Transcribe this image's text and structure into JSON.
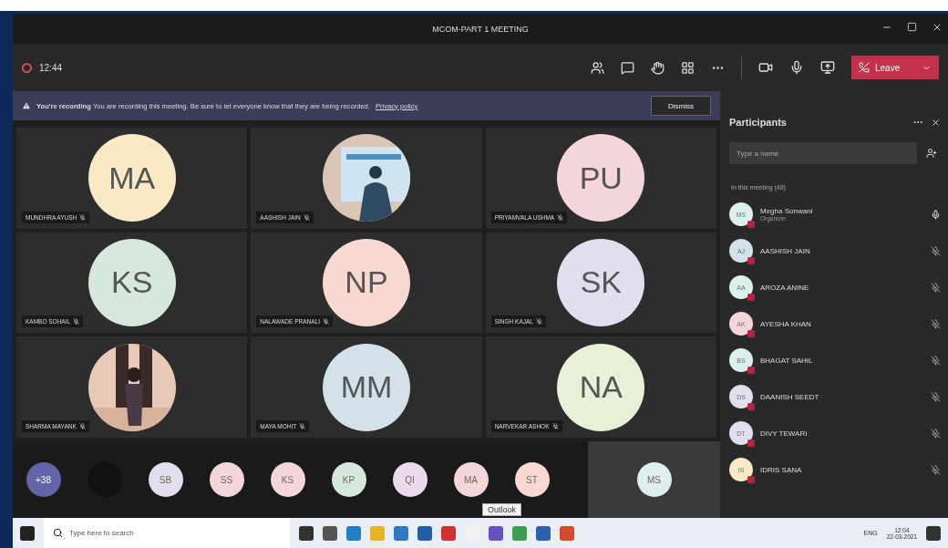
{
  "window": {
    "title": "MCOM-PART 1 MEETING"
  },
  "toolbar": {
    "timer": "12:44",
    "leave": "Leave"
  },
  "banner": {
    "text": "**You're recording** You are recording this meeting. Be sure to let everyone know that they are being recorded.",
    "link": "Privacy policy",
    "button": "Dismiss"
  },
  "tiles": [
    {
      "kind": "initials",
      "initials": "MA",
      "name": "MUNDHRA AYUSH",
      "color": "#f9e9c4"
    },
    {
      "kind": "picture",
      "name": "AASHISH JAIN"
    },
    {
      "kind": "initials",
      "initials": "PU",
      "name": "PRIYAMVALA USHMA",
      "color": "#f4d6da"
    },
    {
      "kind": "initials",
      "initials": "KS",
      "name": "KAMBO SOHAIL",
      "color": "#d6e8dc"
    },
    {
      "kind": "initials",
      "initials": "NP",
      "name": "NALAWADE PRANALI",
      "color": "#f8d9d2"
    },
    {
      "kind": "initials",
      "initials": "SK",
      "name": "SINGH KAJAL",
      "color": "#e2def0"
    },
    {
      "kind": "picture",
      "name": "SHARMA MAYANK"
    },
    {
      "kind": "initials",
      "initials": "MM",
      "name": "MAYA MOHIT",
      "color": "#d3e2e8"
    },
    {
      "kind": "initials",
      "initials": "NA",
      "name": "NARVEKAR ASHOK",
      "color": "#e8f0d8"
    }
  ],
  "strip": [
    {
      "kind": "more",
      "label": "+38",
      "color": "#6264a7"
    },
    {
      "kind": "blank",
      "color": "#111111"
    },
    {
      "kind": "initials",
      "label": "SB",
      "color": "#e2def0"
    },
    {
      "kind": "initials",
      "label": "SS",
      "color": "#f4d6da"
    },
    {
      "kind": "initials",
      "label": "KS",
      "color": "#f4d6da"
    },
    {
      "kind": "initials",
      "label": "KP",
      "color": "#d6e8dc"
    },
    {
      "kind": "initials",
      "label": "QI",
      "color": "#ecd9ec"
    },
    {
      "kind": "initials",
      "label": "MA",
      "color": "#f4d6da"
    },
    {
      "kind": "initials",
      "label": "ST",
      "color": "#f8d9d2"
    },
    {
      "kind": "speaking",
      "label": "MS",
      "color": "#dcefec"
    }
  ],
  "tooltip": "Outlook",
  "participants": {
    "title": "Participants",
    "search": {
      "placeholder": "Type a name"
    },
    "section": "In this meeting (49)",
    "people": [
      {
        "name": "Megha Sonwani",
        "role": "Organizer",
        "initials": "MS",
        "color": "#dcefec",
        "muted": false
      },
      {
        "name": "AASHISH JAIN",
        "initials": "AJ",
        "color": "#d3e2e8",
        "muted": true
      },
      {
        "name": "AROZA ANINE",
        "initials": "AA",
        "color": "#dcefec",
        "muted": true
      },
      {
        "name": "AYESHA KHAN",
        "initials": "AK",
        "color": "#f4d6da",
        "muted": true
      },
      {
        "name": "BHAGAT SAHIL",
        "initials": "BS",
        "color": "#dcefec",
        "muted": true
      },
      {
        "name": "DAANISH SEEDT",
        "initials": "DS",
        "color": "#e2def0",
        "muted": true
      },
      {
        "name": "DIVY TEWARI",
        "initials": "DT",
        "color": "#e2def0",
        "muted": true
      },
      {
        "name": "IDRIS SANA",
        "initials": "IS",
        "color": "#f9e9c4",
        "muted": true
      }
    ]
  },
  "taskbar": {
    "search": {
      "placeholder": "Type here to search"
    },
    "lang": "ENG",
    "time": "12:04",
    "date": "22-03-2021"
  }
}
